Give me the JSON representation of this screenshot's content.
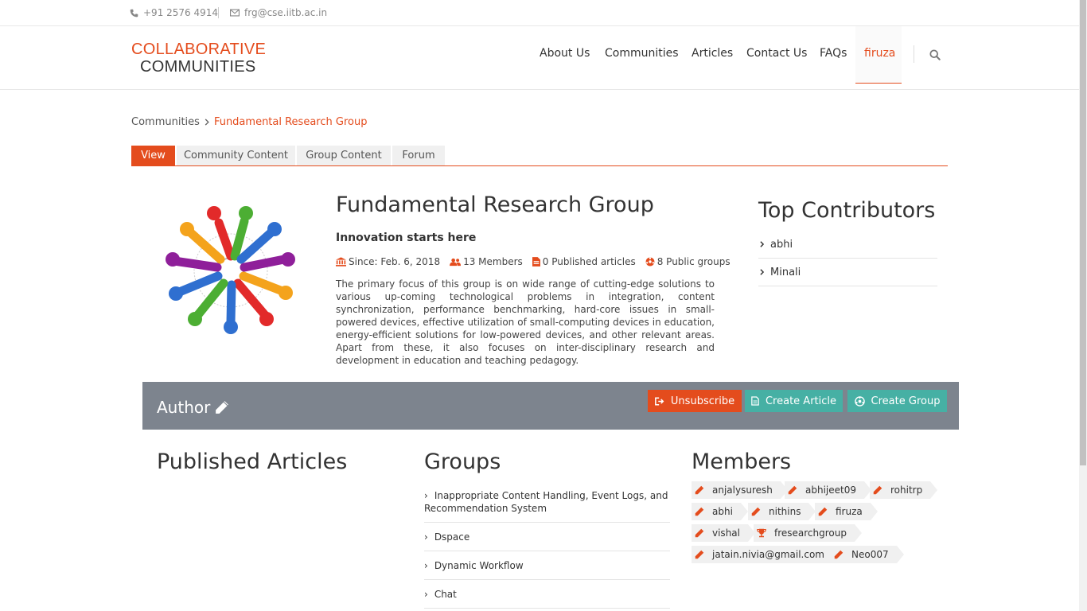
{
  "topbar": {
    "phone": "+91 2576 4914",
    "email": "frg@cse.iitb.ac.in"
  },
  "logo": {
    "line1": "COLLABORATIVE",
    "line2": "COMMUNITIES"
  },
  "nav": {
    "items": [
      "About Us",
      "Communities",
      "Articles",
      "Contact Us",
      "FAQs",
      "firuza"
    ],
    "active_index": 5
  },
  "breadcrumb": {
    "parent": "Communities",
    "current": "Fundamental Research Group"
  },
  "tabs": [
    "View",
    "Community Content",
    "Group Content",
    "Forum"
  ],
  "group": {
    "title": "Fundamental Research Group",
    "tagline": "Innovation starts here",
    "since": "Since: Feb. 6, 2018",
    "members": "13 Members",
    "published": "0 Published articles",
    "public_groups": "8 Public groups",
    "description": "The primary focus of this group is on wide range of cutting-edge solutions to various up-coming technological problems in integration, content synchronization, performance benchmarking, hard-core issues in small-powered devices, effective utilization of small-computing devices in education, energy-efficient solutions for low-powered devices, and other relevant areas. Apart from these, it also focuses on inter-disciplinary research and development in education and teaching pedagogy."
  },
  "top_contributors": {
    "title": "Top Contributors",
    "items": [
      "abhi",
      "Minali"
    ]
  },
  "author_bar": {
    "label": "Author",
    "unsubscribe": "Unsubscribe",
    "create_article": "Create Article",
    "create_group": "Create Group"
  },
  "sections": {
    "published": "Published Articles",
    "groups": "Groups",
    "members": "Members"
  },
  "groups_list": [
    "Inappropriate Content Handling, Event Logs, and Recommendation System",
    "Dspace",
    "Dynamic Workflow",
    "Chat"
  ],
  "members_list": [
    {
      "name": "anjalysuresh",
      "icon": "pencil-icon"
    },
    {
      "name": "abhijeet09",
      "icon": "pencil-icon"
    },
    {
      "name": "rohitrp",
      "icon": "pencil-icon"
    },
    {
      "name": "abhi",
      "icon": "pencil-icon"
    },
    {
      "name": "nithins",
      "icon": "pencil-icon"
    },
    {
      "name": "firuza",
      "icon": "pencil-icon"
    },
    {
      "name": "vishal",
      "icon": "pencil-icon"
    },
    {
      "name": "fresearchgroup",
      "icon": "trophy-icon"
    },
    {
      "name": "jatain.nivia@gmail.com",
      "icon": "pencil-icon"
    },
    {
      "name": "Neo007",
      "icon": "pencil-icon"
    }
  ],
  "colors": {
    "accent": "#e44c1d",
    "teal": "#46b0a4",
    "author_bar": "#7d848e"
  }
}
